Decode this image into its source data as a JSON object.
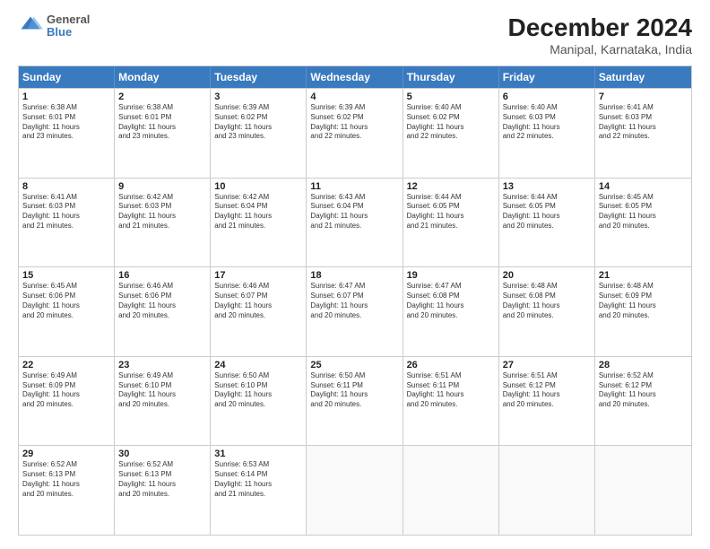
{
  "logo": {
    "line1": "General",
    "line2": "Blue"
  },
  "title": "December 2024",
  "subtitle": "Manipal, Karnataka, India",
  "headers": [
    "Sunday",
    "Monday",
    "Tuesday",
    "Wednesday",
    "Thursday",
    "Friday",
    "Saturday"
  ],
  "weeks": [
    [
      {
        "day": "1",
        "text": "Sunrise: 6:38 AM\nSunset: 6:01 PM\nDaylight: 11 hours\nand 23 minutes."
      },
      {
        "day": "2",
        "text": "Sunrise: 6:38 AM\nSunset: 6:01 PM\nDaylight: 11 hours\nand 23 minutes."
      },
      {
        "day": "3",
        "text": "Sunrise: 6:39 AM\nSunset: 6:02 PM\nDaylight: 11 hours\nand 23 minutes."
      },
      {
        "day": "4",
        "text": "Sunrise: 6:39 AM\nSunset: 6:02 PM\nDaylight: 11 hours\nand 22 minutes."
      },
      {
        "day": "5",
        "text": "Sunrise: 6:40 AM\nSunset: 6:02 PM\nDaylight: 11 hours\nand 22 minutes."
      },
      {
        "day": "6",
        "text": "Sunrise: 6:40 AM\nSunset: 6:03 PM\nDaylight: 11 hours\nand 22 minutes."
      },
      {
        "day": "7",
        "text": "Sunrise: 6:41 AM\nSunset: 6:03 PM\nDaylight: 11 hours\nand 22 minutes."
      }
    ],
    [
      {
        "day": "8",
        "text": "Sunrise: 6:41 AM\nSunset: 6:03 PM\nDaylight: 11 hours\nand 21 minutes."
      },
      {
        "day": "9",
        "text": "Sunrise: 6:42 AM\nSunset: 6:03 PM\nDaylight: 11 hours\nand 21 minutes."
      },
      {
        "day": "10",
        "text": "Sunrise: 6:42 AM\nSunset: 6:04 PM\nDaylight: 11 hours\nand 21 minutes."
      },
      {
        "day": "11",
        "text": "Sunrise: 6:43 AM\nSunset: 6:04 PM\nDaylight: 11 hours\nand 21 minutes."
      },
      {
        "day": "12",
        "text": "Sunrise: 6:44 AM\nSunset: 6:05 PM\nDaylight: 11 hours\nand 21 minutes."
      },
      {
        "day": "13",
        "text": "Sunrise: 6:44 AM\nSunset: 6:05 PM\nDaylight: 11 hours\nand 20 minutes."
      },
      {
        "day": "14",
        "text": "Sunrise: 6:45 AM\nSunset: 6:05 PM\nDaylight: 11 hours\nand 20 minutes."
      }
    ],
    [
      {
        "day": "15",
        "text": "Sunrise: 6:45 AM\nSunset: 6:06 PM\nDaylight: 11 hours\nand 20 minutes."
      },
      {
        "day": "16",
        "text": "Sunrise: 6:46 AM\nSunset: 6:06 PM\nDaylight: 11 hours\nand 20 minutes."
      },
      {
        "day": "17",
        "text": "Sunrise: 6:46 AM\nSunset: 6:07 PM\nDaylight: 11 hours\nand 20 minutes."
      },
      {
        "day": "18",
        "text": "Sunrise: 6:47 AM\nSunset: 6:07 PM\nDaylight: 11 hours\nand 20 minutes."
      },
      {
        "day": "19",
        "text": "Sunrise: 6:47 AM\nSunset: 6:08 PM\nDaylight: 11 hours\nand 20 minutes."
      },
      {
        "day": "20",
        "text": "Sunrise: 6:48 AM\nSunset: 6:08 PM\nDaylight: 11 hours\nand 20 minutes."
      },
      {
        "day": "21",
        "text": "Sunrise: 6:48 AM\nSunset: 6:09 PM\nDaylight: 11 hours\nand 20 minutes."
      }
    ],
    [
      {
        "day": "22",
        "text": "Sunrise: 6:49 AM\nSunset: 6:09 PM\nDaylight: 11 hours\nand 20 minutes."
      },
      {
        "day": "23",
        "text": "Sunrise: 6:49 AM\nSunset: 6:10 PM\nDaylight: 11 hours\nand 20 minutes."
      },
      {
        "day": "24",
        "text": "Sunrise: 6:50 AM\nSunset: 6:10 PM\nDaylight: 11 hours\nand 20 minutes."
      },
      {
        "day": "25",
        "text": "Sunrise: 6:50 AM\nSunset: 6:11 PM\nDaylight: 11 hours\nand 20 minutes."
      },
      {
        "day": "26",
        "text": "Sunrise: 6:51 AM\nSunset: 6:11 PM\nDaylight: 11 hours\nand 20 minutes."
      },
      {
        "day": "27",
        "text": "Sunrise: 6:51 AM\nSunset: 6:12 PM\nDaylight: 11 hours\nand 20 minutes."
      },
      {
        "day": "28",
        "text": "Sunrise: 6:52 AM\nSunset: 6:12 PM\nDaylight: 11 hours\nand 20 minutes."
      }
    ],
    [
      {
        "day": "29",
        "text": "Sunrise: 6:52 AM\nSunset: 6:13 PM\nDaylight: 11 hours\nand 20 minutes."
      },
      {
        "day": "30",
        "text": "Sunrise: 6:52 AM\nSunset: 6:13 PM\nDaylight: 11 hours\nand 20 minutes."
      },
      {
        "day": "31",
        "text": "Sunrise: 6:53 AM\nSunset: 6:14 PM\nDaylight: 11 hours\nand 21 minutes."
      },
      {
        "day": "",
        "text": ""
      },
      {
        "day": "",
        "text": ""
      },
      {
        "day": "",
        "text": ""
      },
      {
        "day": "",
        "text": ""
      }
    ]
  ]
}
